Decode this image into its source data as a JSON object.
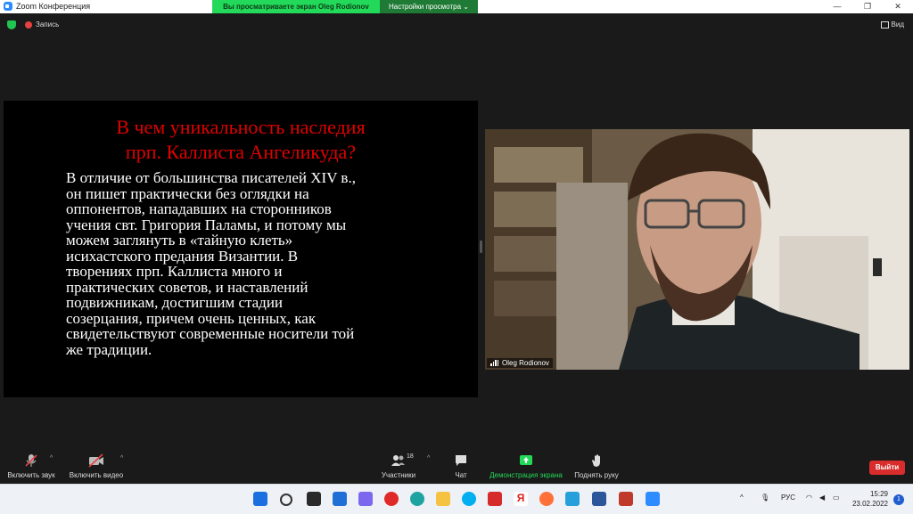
{
  "window": {
    "title": "Zoom Конференция"
  },
  "share_banner": {
    "viewing_text": "Вы просматриваете экран Oleg Rodionov",
    "options_label": "Настройки просмотра"
  },
  "topbar": {
    "record_label": "Запись",
    "view_label": "Вид"
  },
  "slide": {
    "title_line1": "В чем уникальность наследия",
    "title_line2": "прп. Каллиста Ангеликуда?",
    "body_lines": [
      "В отличие от большинства писателей XIV в.,",
      "он пишет практически без оглядки на",
      "оппонентов, нападавших на сторонников",
      "учения свт. Григория Паламы, и потому мы",
      "можем заглянуть в «тайную клеть»",
      "исихастского предания Византии. В",
      "творениях прп. Каллиста много и",
      "практических советов, и наставлений",
      "подвижникам, достигшим стадии",
      "созерцания, причем очень ценных, как",
      "свидетельствуют современные носители той",
      "же традиции."
    ]
  },
  "video": {
    "participant_name": "Oleg Rodionov"
  },
  "toolbar": {
    "audio_label": "Включить звук",
    "video_label": "Включить видео",
    "participants_label": "Участники",
    "participants_count": "18",
    "chat_label": "Чат",
    "share_label": "Демонстрация экрана",
    "raise_hand_label": "Поднять руку",
    "leave_label": "Выйти"
  },
  "taskbar": {
    "language": "РУС",
    "time": "15:29",
    "date": "23.02.2022",
    "notifications": "1"
  },
  "colors": {
    "accent_green": "#23d959",
    "zoom_blue": "#2d8cff",
    "leave_red": "#d92c2c",
    "slide_title_red": "#e00000"
  }
}
